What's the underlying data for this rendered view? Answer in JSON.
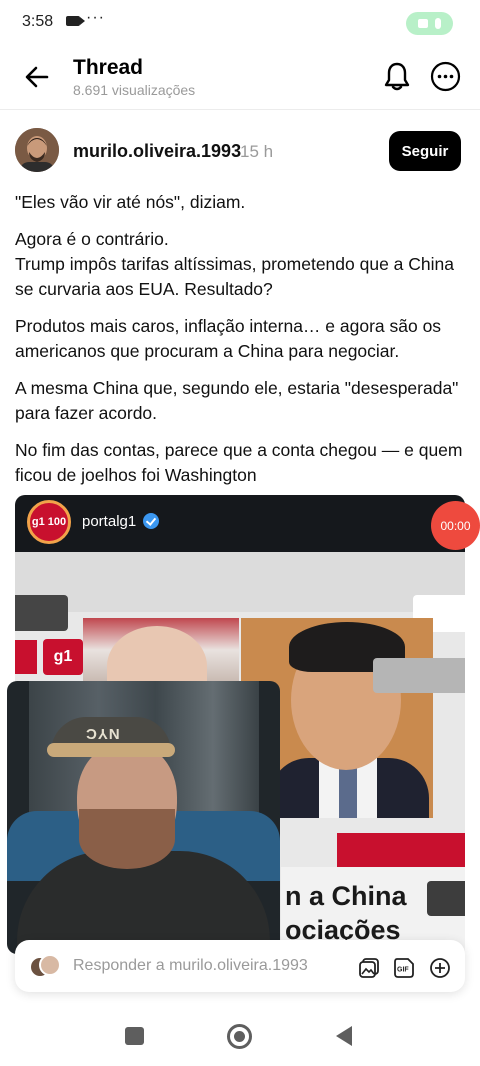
{
  "status_bar": {
    "time": "3:58",
    "dots": "···"
  },
  "header": {
    "title": "Thread",
    "views": "8.691 visualizações"
  },
  "post": {
    "username": "murilo.oliveira.1993",
    "time": "15 h",
    "follow_label": "Seguir",
    "paragraphs": [
      "\"Eles vão vir até nós\", diziam.",
      "Agora é o contrário.",
      "Trump impôs tarifas altíssimas, prometendo que a China se curvaria aos EUA. Resultado?",
      "Produtos mais caros, inflação interna… e agora são os americanos que procuram a China para negociar.",
      "A mesma China que, segundo ele, estaria \"desesperada\" para fazer acordo.",
      "No fim das contas, parece que a conta chegou — e quem ficou de joelhos foi Washington"
    ]
  },
  "media": {
    "account": "portalg1",
    "logo_text": "g1 100",
    "badge": "g1",
    "headline_line1": "n a China",
    "headline_line2": "ociações",
    "pip_cap_text": "NYC",
    "recording_time": "00:00"
  },
  "reply": {
    "placeholder": "Responder a murilo.oliveira.1993"
  },
  "colors": {
    "accent": "#000000",
    "verified": "#3b97f0",
    "brand_red": "#c8102e",
    "record": "#ee4a3e"
  },
  "icons": [
    "back-arrow-icon",
    "bell-icon",
    "more-icon",
    "verified-icon",
    "image-icon",
    "gif-icon",
    "add-icon"
  ]
}
